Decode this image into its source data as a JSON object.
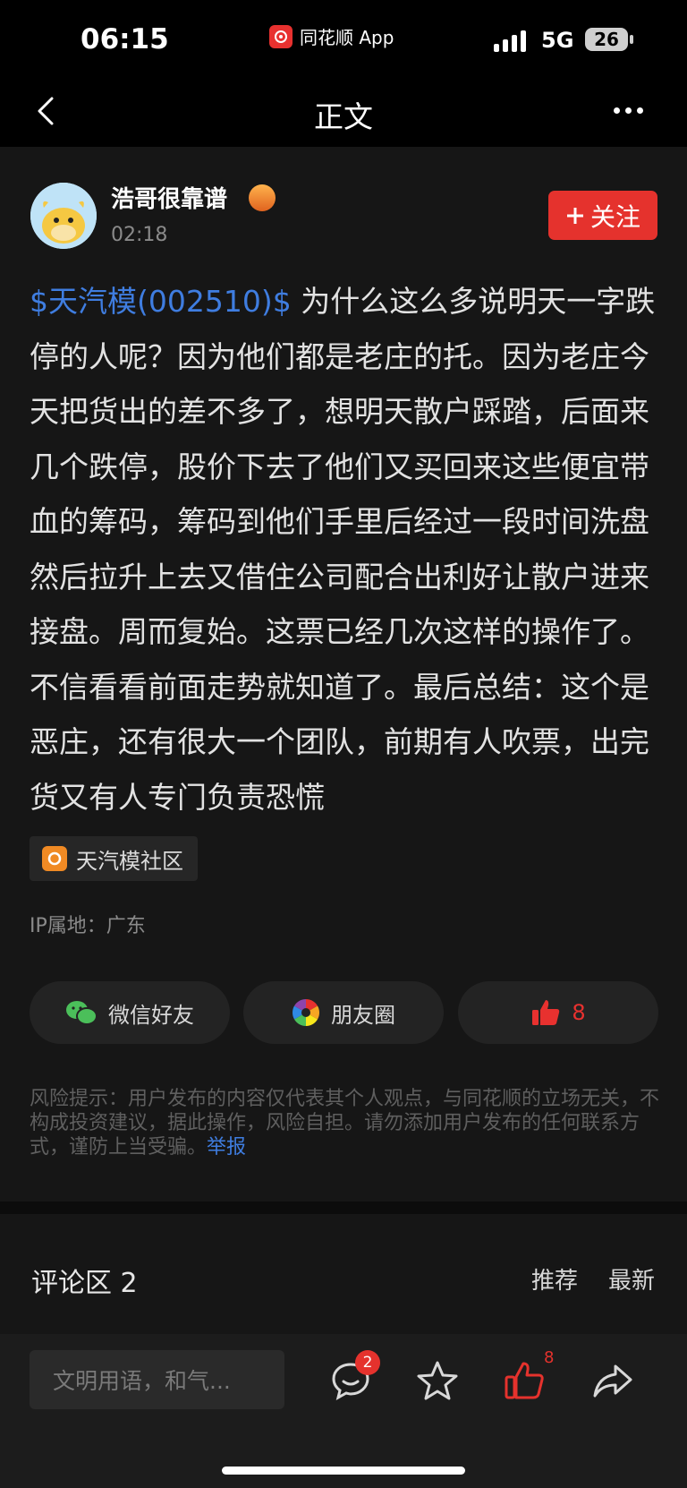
{
  "status_bar": {
    "time": "06:15",
    "app_name": "同花顺 App",
    "network": "5G",
    "battery": "26"
  },
  "nav": {
    "title": "正文"
  },
  "post": {
    "author": "浩哥很靠谱",
    "time": "02:18",
    "follow_label": "关注",
    "stock_tag": "$天汽模(002510)$",
    "body": " 为什么这么多说明天一字跌停的人呢？因为他们都是老庄的托。因为老庄今天把货出的差不多了，想明天散户踩踏，后面来几个跌停，股价下去了他们又买回来这些便宜带血的筹码，筹码到他们手里后经过一段时间洗盘然后拉升上去又借住公司配合出利好让散户进来接盘。周而复始。这票已经几次这样的操作了。不信看看前面走势就知道了。最后总结：这个是恶庄，还有很大一个团队，前期有人吹票，出完货又有人专门负责恐慌",
    "community": "天汽模社区",
    "ip_location": "IP属地：广东"
  },
  "share": {
    "wechat_friend": "微信好友",
    "moments": "朋友圈",
    "like_count": "8"
  },
  "risk_notice": {
    "text": "风险提示：用户发布的内容仅代表其个人观点，与同花顺的立场无关，不构成投资建议，据此操作，风险自担。请勿添加用户发布的任何联系方式，谨防上当受骗。",
    "report_label": "举报"
  },
  "comments": {
    "title": "评论区 2",
    "sort_recommend": "推荐",
    "sort_latest": "最新"
  },
  "bottom_bar": {
    "input_placeholder": "文明用语，和气...",
    "comment_count": "2",
    "like_count": "8"
  },
  "colors": {
    "accent_red": "#e5322d",
    "link_blue": "#3f7de0",
    "background": "#161616"
  }
}
